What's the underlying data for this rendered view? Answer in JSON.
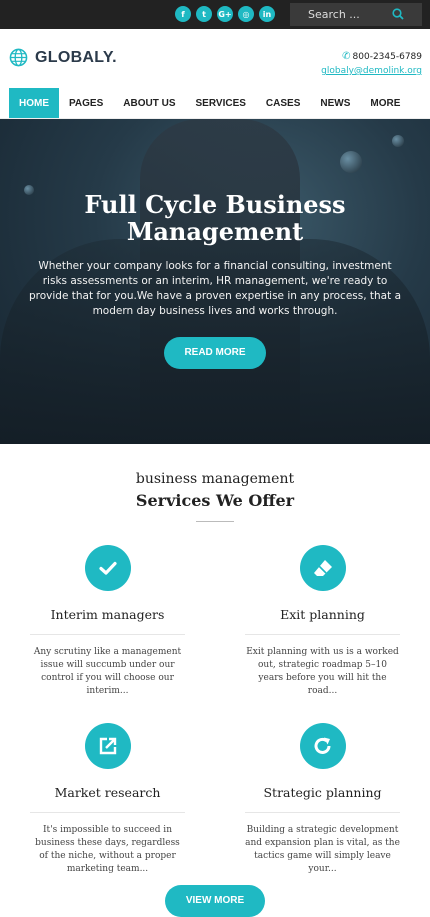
{
  "topbar": {
    "social": [
      "f",
      "t",
      "G+",
      "◎",
      "in"
    ],
    "search_placeholder": "Search ..."
  },
  "header": {
    "brand": "GLOBALY.",
    "phone": "800-2345-6789",
    "email": "globaly@demolink.org"
  },
  "nav": [
    "HOME",
    "PAGES",
    "ABOUT US",
    "SERVICES",
    "CASES",
    "NEWS",
    "MORE"
  ],
  "hero": {
    "title": "Full Cycle Business Management",
    "text": "Whether your company looks for a financial consulting, investment risks assessments or an interim, HR management, we're ready to provide that for you.We have a proven expertise in any process, that a modern day business lives and works through.",
    "button": "READ MORE"
  },
  "services": {
    "subtitle": "business management",
    "title": "Services We Offer",
    "items": [
      {
        "icon": "checkmark-icon",
        "title": "Interim managers",
        "text": "Any scrutiny like a management issue will succumb under our control if you will choose our interim..."
      },
      {
        "icon": "eraser-icon",
        "title": "Exit planning",
        "text": "Exit planning with us is a worked out, strategic roadmap 5–10 years before you will hit the road..."
      },
      {
        "icon": "external-link-icon",
        "title": "Market research",
        "text": "It's impossible to succeed in business these days, regardless of the niche, without a proper marketing team..."
      },
      {
        "icon": "refresh-icon",
        "title": "Strategic planning",
        "text": "Building a strategic development and expansion plan is vital, as the tactics game will simply leave your..."
      }
    ],
    "view_more": "VIEW MORE"
  },
  "colors": {
    "accent": "#1fb9c3",
    "topbar": "#222222"
  }
}
